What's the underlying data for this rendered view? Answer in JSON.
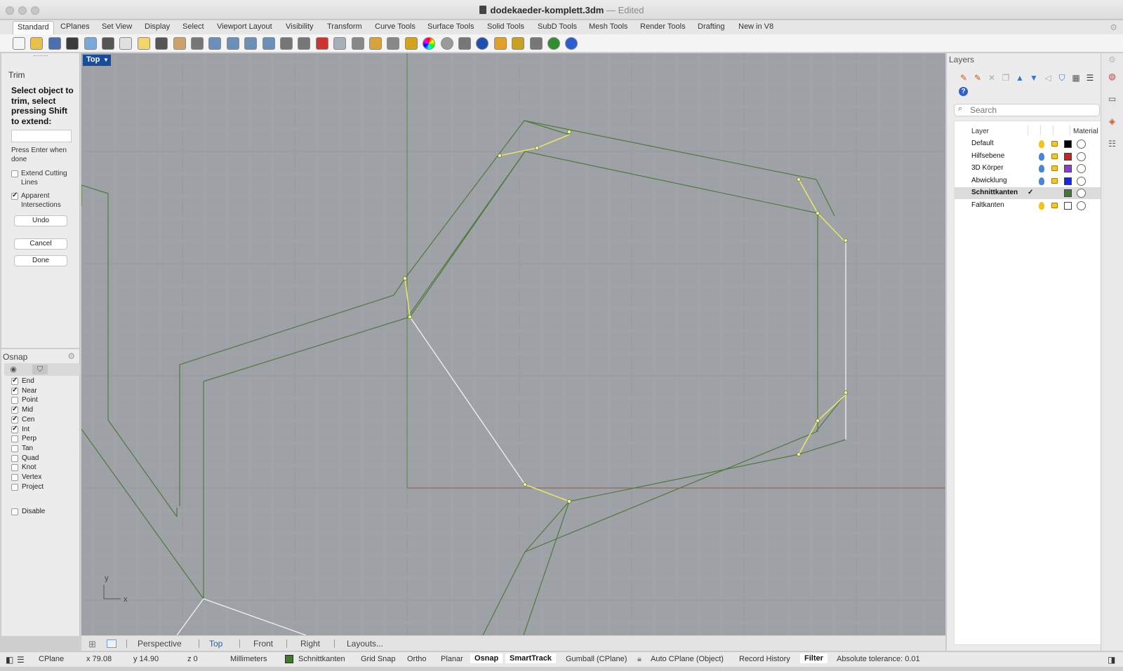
{
  "window": {
    "title": "dodekaeder-komplett.3dm",
    "edited_suffix": "— Edited"
  },
  "tabs": [
    {
      "label": "Standard",
      "active": true
    },
    {
      "label": "CPlanes"
    },
    {
      "label": "Set View"
    },
    {
      "label": "Display"
    },
    {
      "label": "Select"
    },
    {
      "label": "Viewport Layout"
    },
    {
      "label": "Visibility"
    },
    {
      "label": "Transform"
    },
    {
      "label": "Curve Tools"
    },
    {
      "label": "Surface Tools"
    },
    {
      "label": "Solid Tools"
    },
    {
      "label": "SubD Tools"
    },
    {
      "label": "Mesh Tools"
    },
    {
      "label": "Render Tools"
    },
    {
      "label": "Drafting"
    },
    {
      "label": "New in V8"
    }
  ],
  "toolbar_icons": [
    "new-file-icon",
    "open-file-icon",
    "save-icon",
    "print-icon",
    "import-icon",
    "cut-icon",
    "copy-icon",
    "paste-icon",
    "undo-icon",
    "pan-hand-icon",
    "rotate-view-icon",
    "zoom-icon",
    "zoom-window-icon",
    "zoom-extents-icon",
    "zoom-selected-icon",
    "undo-view-icon",
    "grid-icon",
    "car-icon",
    "surface-icon",
    "cplane-icon",
    "snap-icon",
    "light-icon",
    "lock-icon",
    "color-wheel-icon",
    "shaded-sphere-icon",
    "rendered-icon",
    "render-sphere-icon",
    "material-icon",
    "gear-settings-icon",
    "dimension-icon",
    "globe-icon",
    "help-icon"
  ],
  "command": {
    "name": "Trim",
    "prompt": "Select object to trim, select pressing Shift to extend:",
    "input_value": "",
    "hint": "Press Enter when done",
    "options": [
      {
        "label": "Extend Cutting Lines",
        "checked": false
      },
      {
        "label": "Apparent Intersections",
        "checked": true
      }
    ],
    "buttons": {
      "undo": "Undo",
      "cancel": "Cancel",
      "done": "Done"
    }
  },
  "osnap": {
    "title": "Osnap",
    "items": [
      {
        "label": "End",
        "checked": true
      },
      {
        "label": "Near",
        "checked": true
      },
      {
        "label": "Point",
        "checked": false
      },
      {
        "label": "Mid",
        "checked": true
      },
      {
        "label": "Cen",
        "checked": true
      },
      {
        "label": "Int",
        "checked": true
      },
      {
        "label": "Perp",
        "checked": false
      },
      {
        "label": "Tan",
        "checked": false
      },
      {
        "label": "Quad",
        "checked": false
      },
      {
        "label": "Knot",
        "checked": false
      },
      {
        "label": "Vertex",
        "checked": false
      },
      {
        "label": "Project",
        "checked": false
      }
    ],
    "disable_label": "Disable",
    "disable_checked": false
  },
  "viewport": {
    "label": "Top",
    "axis_x": "x",
    "axis_y": "y",
    "tabs": [
      {
        "label": "Perspective"
      },
      {
        "label": "Top",
        "active": true
      },
      {
        "label": "Front"
      },
      {
        "label": "Right"
      },
      {
        "label": "Layouts..."
      }
    ]
  },
  "layers": {
    "title": "Layers",
    "search_placeholder": "Search",
    "col_layer": "Layer",
    "col_material": "Material",
    "rows": [
      {
        "name": "Default",
        "color": "#000000",
        "bulb": "#f0c419"
      },
      {
        "name": "Hilfsebene",
        "color": "#d0201c",
        "bulb": "#4a86d8"
      },
      {
        "name": "3D Körper",
        "color": "#8a3ed0",
        "bulb": "#4a86d8"
      },
      {
        "name": "Abwicklung",
        "color": "#1428e6",
        "bulb": "#4a86d8"
      },
      {
        "name": "Schnittkanten",
        "color": "#3f7d2d",
        "bulb": "",
        "current": true,
        "check": "✓"
      },
      {
        "name": "Faltkanten",
        "color": "#ffffff",
        "bulb": "#f0c419"
      }
    ]
  },
  "status": {
    "cplane": "CPlane",
    "x": "x 79.08",
    "y": "y 14.90",
    "z": "z 0",
    "units": "Millimeters",
    "layer": "Schnittkanten",
    "grid_snap": "Grid Snap",
    "ortho": "Ortho",
    "planar": "Planar",
    "osnap": "Osnap",
    "smarttrack": "SmartTrack",
    "gumball": "Gumball (CPlane)",
    "auto_cplane": "Auto CPlane (Object)",
    "record_history": "Record History",
    "filter": "Filter",
    "tolerance": "Absolute tolerance: 0.01"
  }
}
